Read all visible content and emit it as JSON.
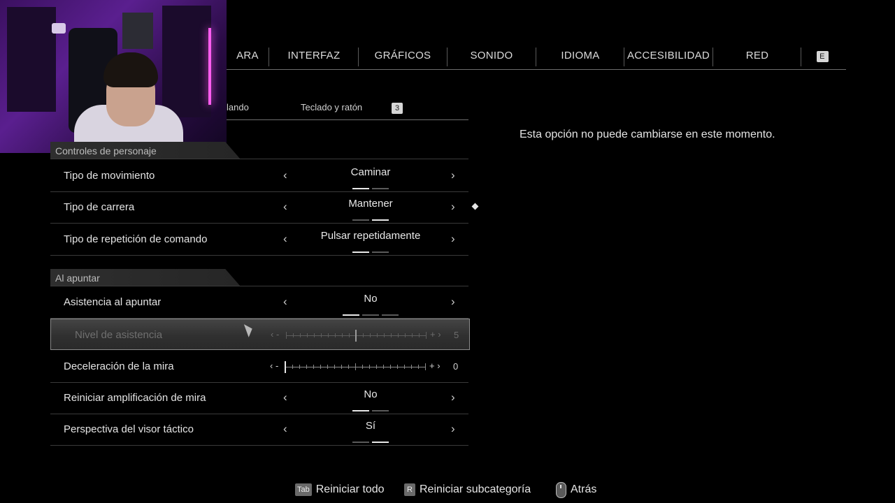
{
  "top_tabs": [
    {
      "label": "ARA"
    },
    {
      "label": "INTERFAZ"
    },
    {
      "label": "GRÁFICOS"
    },
    {
      "label": "SONIDO"
    },
    {
      "label": "IDIOMA"
    },
    {
      "label": "ACCESIBILIDAD"
    },
    {
      "label": "RED"
    }
  ],
  "top_tabs_next_key": "E",
  "sub_tabs": {
    "first": "lando",
    "second": "Teclado y ratón",
    "key": "3"
  },
  "sections": {
    "character": "Controles de personaje",
    "aiming": "Al apuntar"
  },
  "settings": {
    "movement_type": {
      "label": "Tipo de movimiento",
      "value": "Caminar",
      "option_index": 0,
      "option_count": 2
    },
    "run_type": {
      "label": "Tipo de carrera",
      "value": "Mantener",
      "option_index": 1,
      "option_count": 2
    },
    "repeat_type": {
      "label": "Tipo de repetición de comando",
      "value": "Pulsar repetidamente",
      "option_index": 0,
      "option_count": 2
    },
    "aim_assist": {
      "label": "Asistencia al apuntar",
      "value": "No",
      "option_index": 0,
      "option_count": 3
    },
    "assist_level": {
      "label": "Nivel de asistencia",
      "value": "5",
      "min": 0,
      "max": 10,
      "disabled": true
    },
    "reticle_decel": {
      "label": "Deceleración de la mira",
      "value": "0",
      "min": 0,
      "max": 10
    },
    "reset_amp": {
      "label": "Reiniciar amplificación de mira",
      "value": "No",
      "option_index": 0,
      "option_count": 2
    },
    "tactical_view": {
      "label": "Perspectiva del visor táctico",
      "value": "Sí",
      "option_index": 1,
      "option_count": 2
    }
  },
  "slider_glyphs": {
    "left": "‹ -",
    "right": "+ ›"
  },
  "description": "Esta opción no puede cambiarse en este momento.",
  "footer": {
    "reset_all_key": "Tab",
    "reset_all": "Reiniciar todo",
    "reset_sub_key": "R",
    "reset_sub": "Reiniciar subcategoría",
    "back": "Atrás"
  }
}
